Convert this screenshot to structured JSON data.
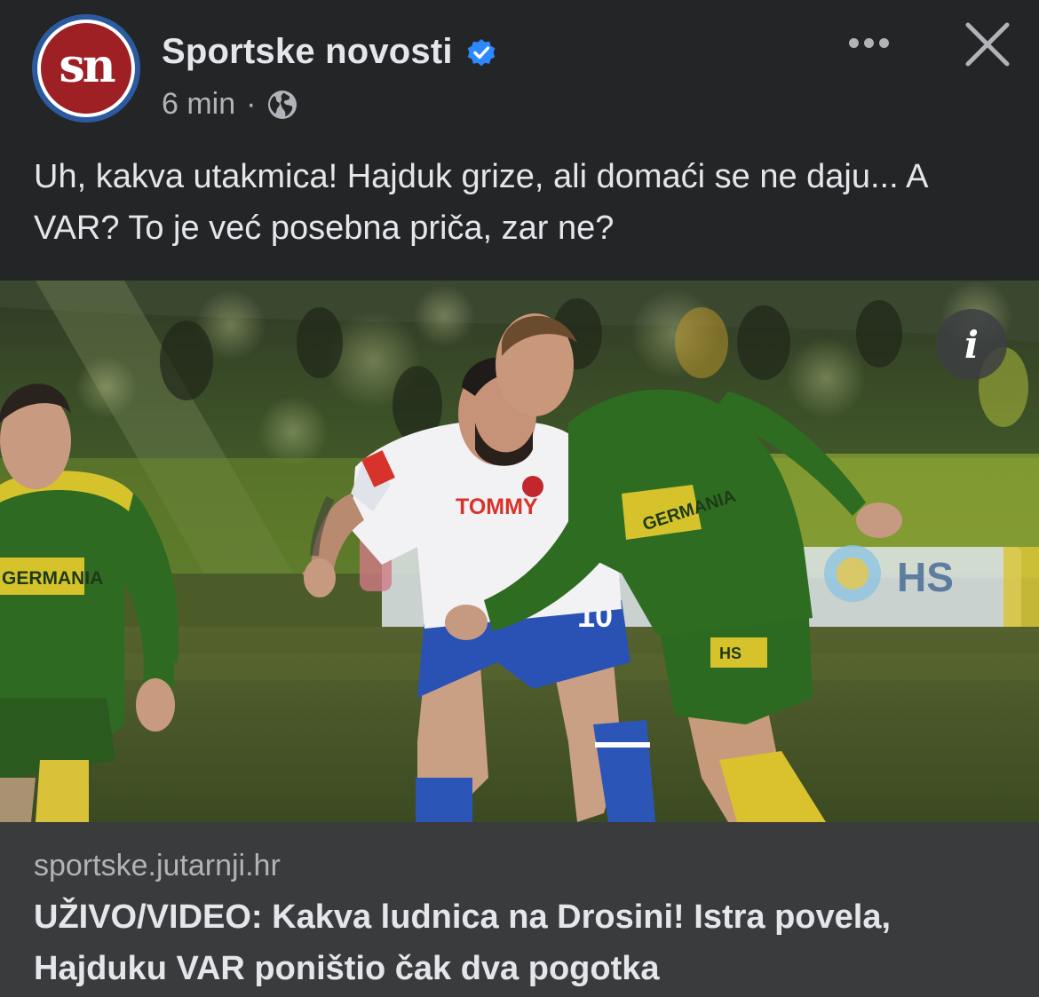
{
  "post": {
    "page_name": "Sportske novosti",
    "avatar_text": "sn",
    "time": "6 min",
    "separator": "·",
    "caption": "Uh, kakva utakmica! Hajduk grize, ali domaći se ne daju... A VAR? To je već posebna priča, zar ne?",
    "info_glyph": "i"
  },
  "image": {
    "jersey_left": "GERMANIA",
    "jersey_center": "TOMMY",
    "jersey_right": "GERMANIA",
    "shirt_number": "10",
    "board_text": "HS"
  },
  "link_preview": {
    "domain": "sportske.jutarnji.hr",
    "headline": "UŽIVO/VIDEO: Kakva ludnica na Drosini! Istra povela, Hajduku VAR poništio čak dva pogotka"
  },
  "icons": [
    "verified-badge-icon",
    "globe-icon",
    "more-options-icon",
    "close-icon",
    "info-icon"
  ],
  "colors": {
    "background": "#242526",
    "link_box": "#3a3b3c",
    "verified": "#2d88ff",
    "brand_red": "#9e1f24",
    "brand_blue": "#2c5aa0"
  }
}
